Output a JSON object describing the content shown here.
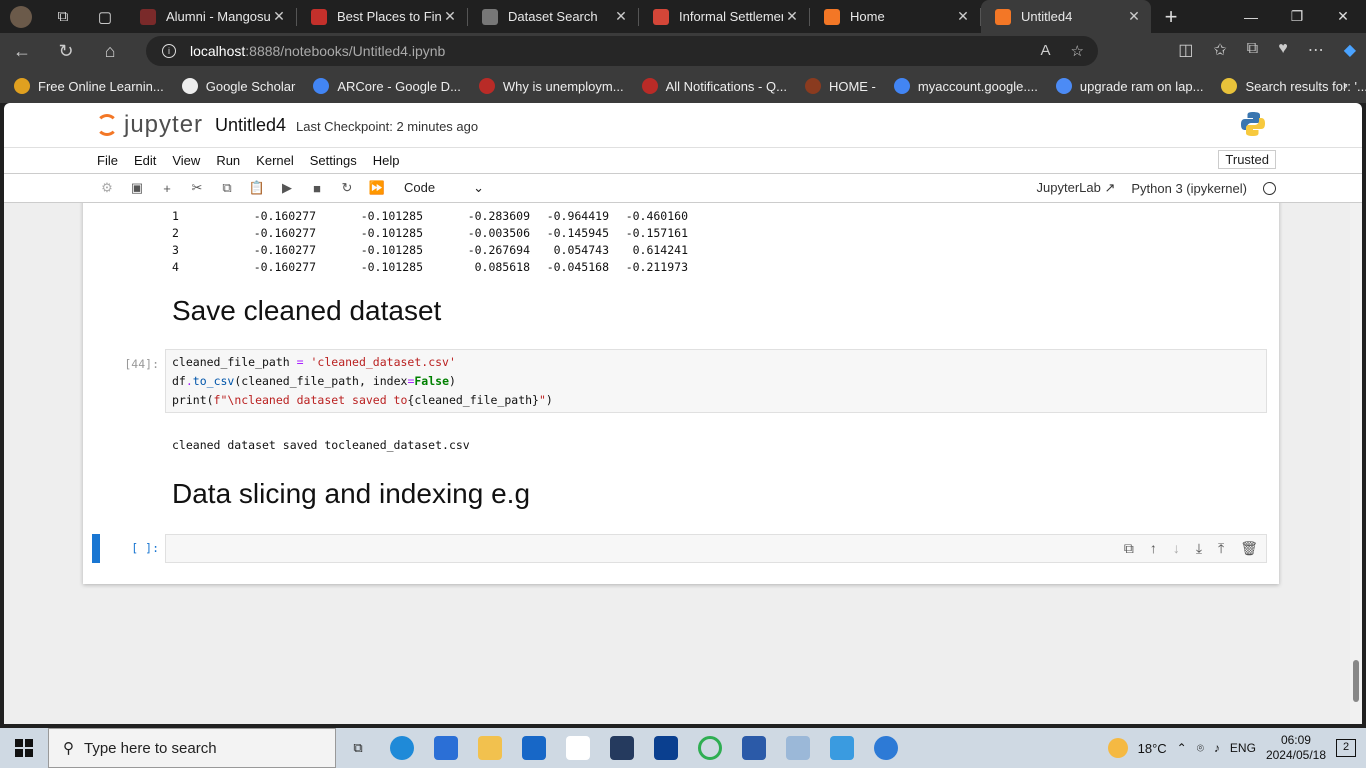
{
  "browser": {
    "tabs": [
      {
        "title": "Alumni - Mangosut",
        "color": "#7a2a2a"
      },
      {
        "title": "Best Places to Find",
        "color": "#c4302b"
      },
      {
        "title": "Dataset Search",
        "color": "#777777"
      },
      {
        "title": "Informal Settlement",
        "color": "#d44638"
      },
      {
        "title": "Home",
        "color": "#f37726"
      },
      {
        "title": "Untitled4",
        "color": "#f37726"
      }
    ],
    "url_host": "localhost",
    "url_path": ":8888/notebooks/Untitled4.ipynb",
    "bookmarks": [
      {
        "label": "Free Online Learnin...",
        "color": "#e0a020"
      },
      {
        "label": "Google Scholar",
        "color": "#eeeeee"
      },
      {
        "label": "ARCore - Google D...",
        "color": "#4285f4"
      },
      {
        "label": "Why is unemploym...",
        "color": "#b92b27"
      },
      {
        "label": "All Notifications - Q...",
        "color": "#b92b27"
      },
      {
        "label": "HOME -",
        "color": "#8a3b1f"
      },
      {
        "label": "myaccount.google....",
        "color": "#4285f4"
      },
      {
        "label": "upgrade ram on lap...",
        "color": "#4c8bf5"
      },
      {
        "label": "Search results for: '...",
        "color": "#e8c23a"
      }
    ]
  },
  "jupyter": {
    "logo_text": "jupyter",
    "notebook_title": "Untitled4",
    "checkpoint": "Last Checkpoint: 2 minutes ago",
    "menu": [
      "File",
      "Edit",
      "View",
      "Run",
      "Kernel",
      "Settings",
      "Help"
    ],
    "trusted": "Trusted",
    "cell_type": "Code",
    "jupyterlab_link": "JupyterLab",
    "kernel_name": "Python 3 (ipykernel)"
  },
  "dataframe_rows": [
    [
      "1",
      "-0.160277",
      "-0.101285",
      "-0.283609",
      "-0.964419",
      "-0.460160"
    ],
    [
      "2",
      "-0.160277",
      "-0.101285",
      "-0.003506",
      "-0.145945",
      "-0.157161"
    ],
    [
      "3",
      "-0.160277",
      "-0.101285",
      "-0.267694",
      "0.054743",
      "0.614241"
    ],
    [
      "4",
      "-0.160277",
      "-0.101285",
      "0.085618",
      "-0.045168",
      "-0.211973"
    ]
  ],
  "notebook": {
    "heading_save": "Save cleaned dataset",
    "cell44_prompt": "[44]:",
    "cell44_output": "cleaned dataset saved tocleaned_dataset.csv",
    "heading_slicing": "Data slicing and indexing e.g",
    "empty_prompt": "[ ]:"
  },
  "taskbar": {
    "search_placeholder": "Type here to search",
    "weather": "18°C",
    "language": "ENG",
    "time": "06:09",
    "date": "2024/05/18",
    "notifications": "2"
  }
}
